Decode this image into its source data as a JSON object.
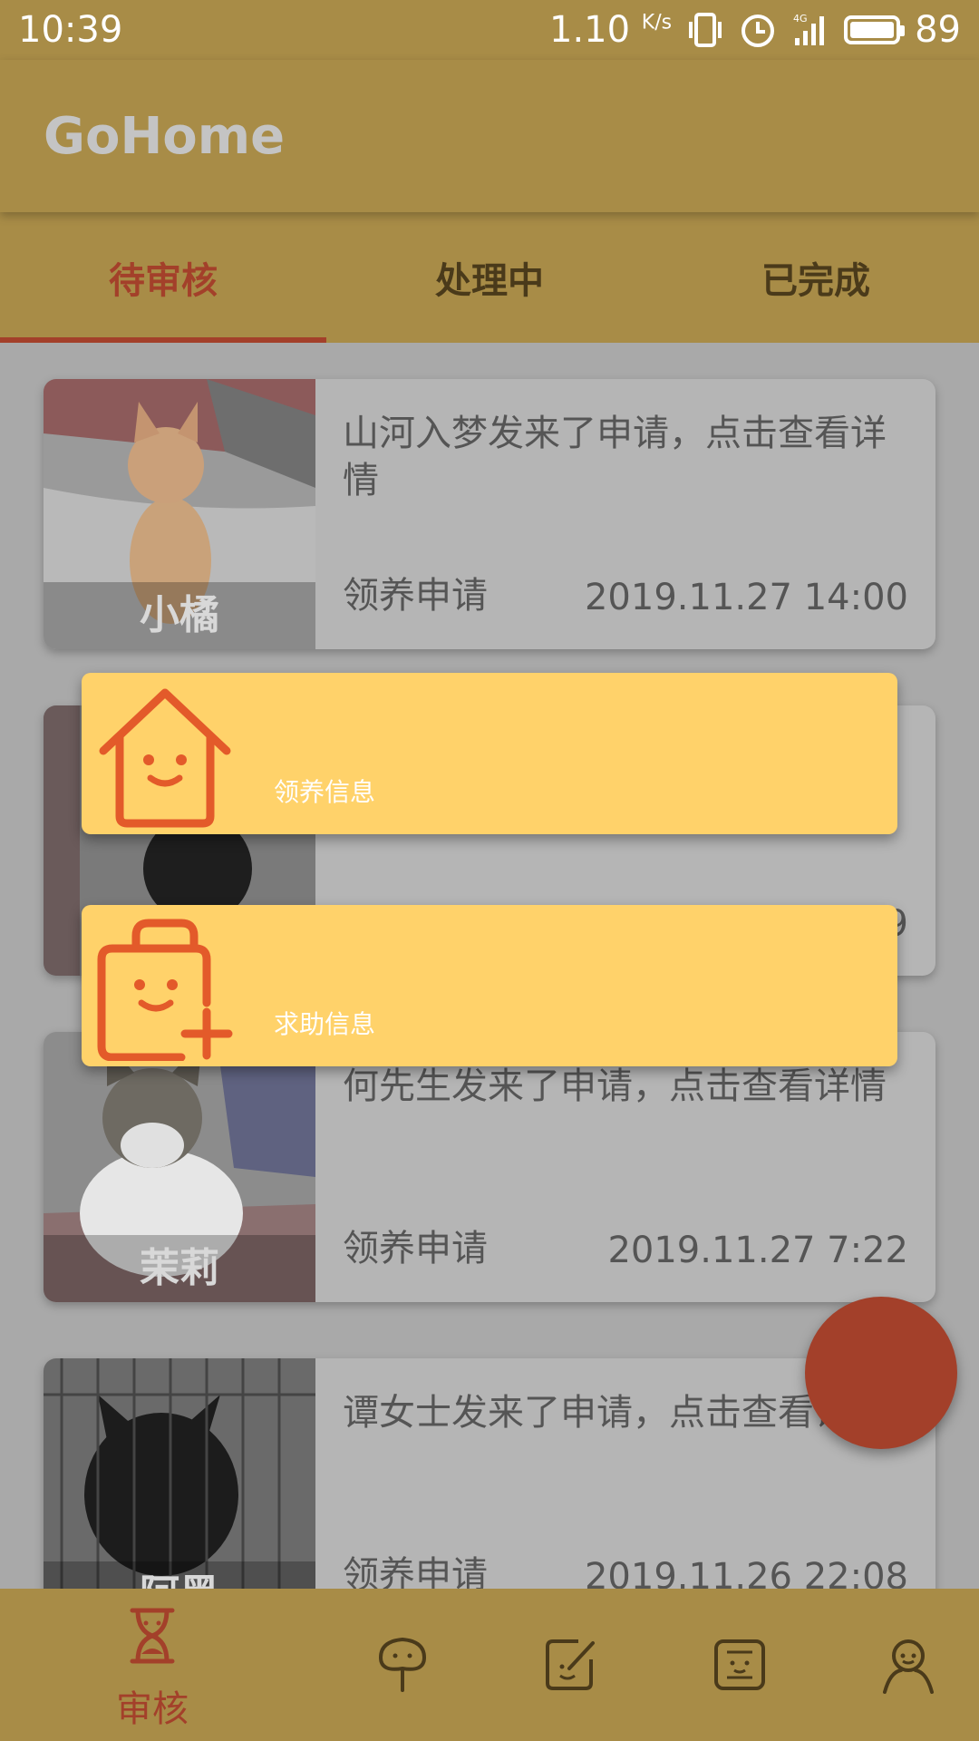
{
  "status_bar": {
    "time": "10:39",
    "net_speed": "1.10",
    "net_unit": "K/s",
    "battery": "89",
    "signal_label": "4G"
  },
  "app_bar": {
    "title": "GoHome"
  },
  "tabs": [
    {
      "label": "待审核",
      "active": true
    },
    {
      "label": "处理中",
      "active": false
    },
    {
      "label": "已完成",
      "active": false
    }
  ],
  "cards": [
    {
      "pet_name": "小橘",
      "message": "山河入梦发来了申请，点击查看详情",
      "type": "领养申请",
      "date": "2019.11.27 14:00"
    },
    {
      "pet_name": "",
      "message": "",
      "type": "",
      "date": "9"
    },
    {
      "pet_name": "茉莉",
      "message": "何先生发来了申请，点击查看详情",
      "type": "领养申请",
      "date": "2019.11.27 7:22"
    },
    {
      "pet_name": "阿黑",
      "message": "谭女士发来了申请，点击查看详情",
      "type": "领养申请",
      "date": "2019.11.26 22:08"
    }
  ],
  "popup_menu": [
    {
      "label": "领养信息",
      "icon": "house-smile-icon"
    },
    {
      "label": "求助信息",
      "icon": "bag-plus-icon"
    }
  ],
  "bottom_nav": [
    {
      "label": "审核",
      "icon": "hourglass-icon",
      "active": true
    },
    {
      "label": "",
      "icon": "leaf-icon",
      "active": false
    },
    {
      "label": "",
      "icon": "edit-icon",
      "active": false
    },
    {
      "label": "",
      "icon": "face-chat-icon",
      "active": false
    },
    {
      "label": "",
      "icon": "person-icon",
      "active": false
    }
  ],
  "colors": {
    "bar": "#a88c47",
    "accent": "#a3402a",
    "popup": "#ffd26a",
    "icon_orange": "#e35a2a"
  }
}
